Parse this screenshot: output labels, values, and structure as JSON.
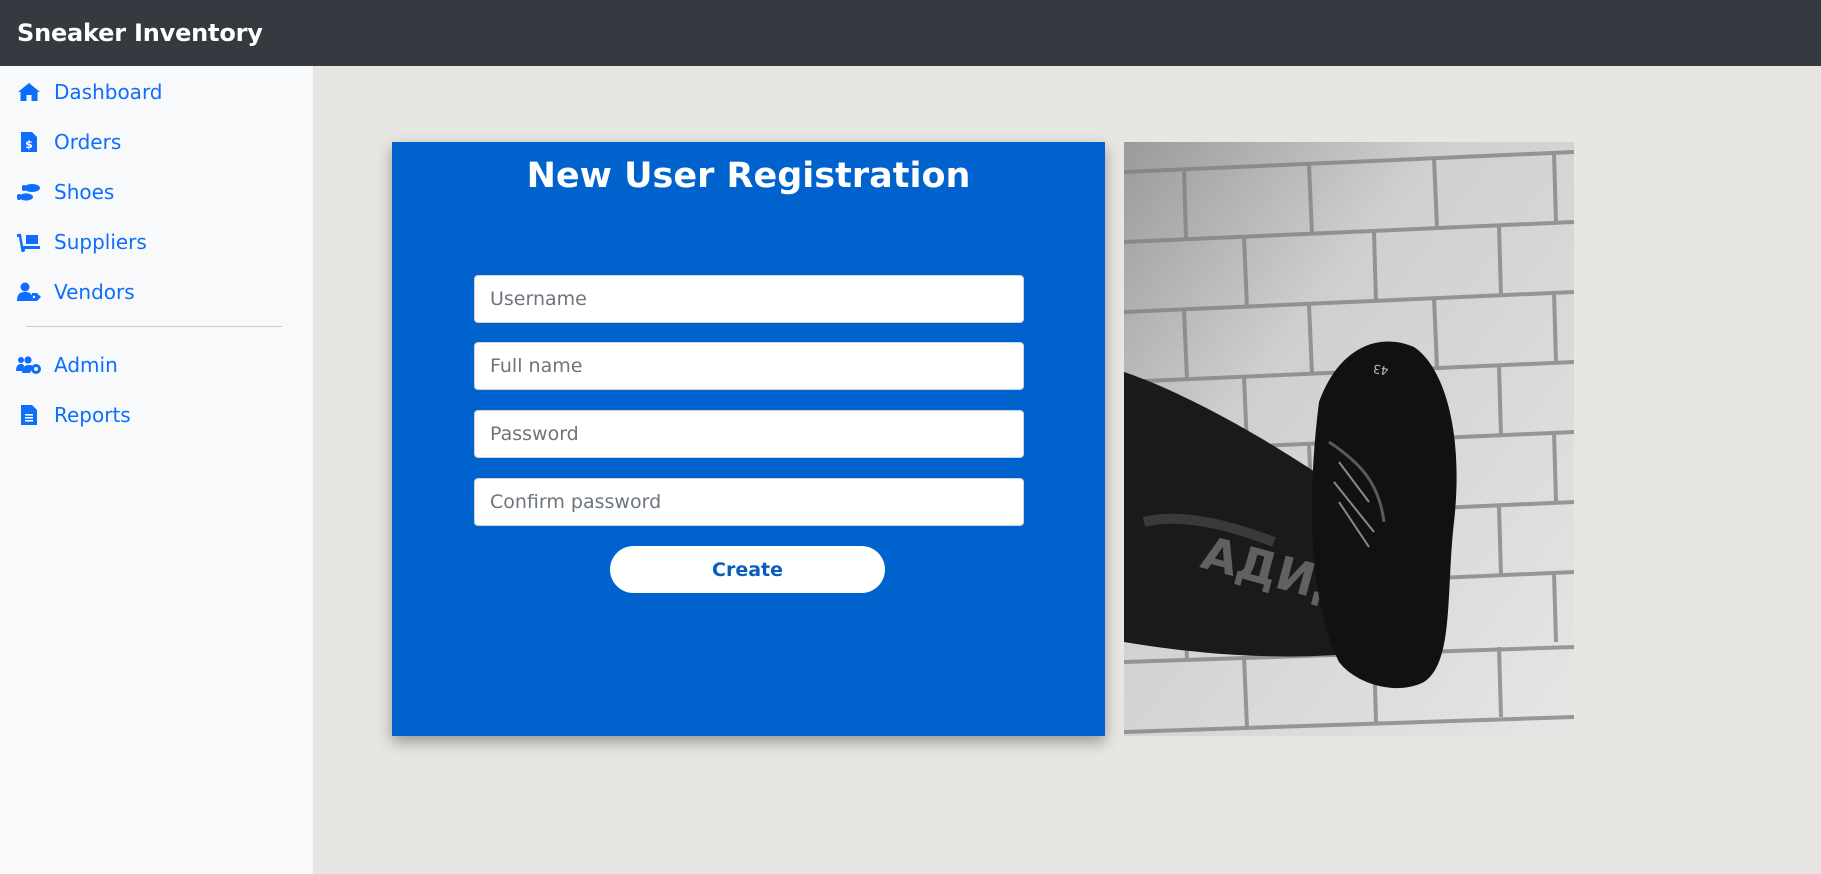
{
  "app": {
    "title": "Sneaker Inventory"
  },
  "sidebar": {
    "items": [
      {
        "label": "Dashboard",
        "icon": "home-icon"
      },
      {
        "label": "Orders",
        "icon": "invoice-dollar-icon"
      },
      {
        "label": "Shoes",
        "icon": "shoe-prints-icon"
      },
      {
        "label": "Suppliers",
        "icon": "dolly-icon"
      },
      {
        "label": "Vendors",
        "icon": "user-tag-icon"
      }
    ],
    "admin_items": [
      {
        "label": "Admin",
        "icon": "users-cog-icon"
      },
      {
        "label": "Reports",
        "icon": "file-alt-icon"
      }
    ]
  },
  "form": {
    "title": "New User Registration",
    "username_placeholder": "Username",
    "fullname_placeholder": "Full name",
    "password_placeholder": "Password",
    "confirm_placeholder": "Confirm password",
    "submit_label": "Create"
  },
  "colors": {
    "topbar": "#343a40",
    "sidebar_bg": "#f8f9fa",
    "link": "#0d6efd",
    "card": "#0062cc",
    "page_bg": "#e8e6e2"
  }
}
